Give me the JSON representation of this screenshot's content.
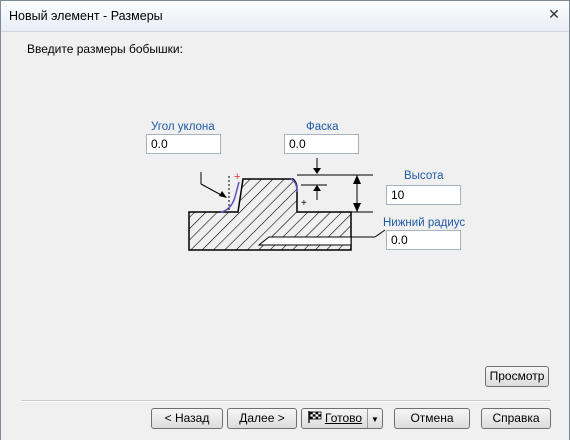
{
  "window": {
    "title": "Новый элемент - Размеры",
    "close_glyph": "✕"
  },
  "prompt": "Введите размеры бобышки:",
  "fields": {
    "draft_angle": {
      "label": "Угол уклона",
      "value": "0.0"
    },
    "chamfer": {
      "label": "Фаска",
      "value": "0.0"
    },
    "height": {
      "label": "Высота",
      "value": "10"
    },
    "bottom_radius": {
      "label": "Нижний радиус",
      "value": "0.0"
    }
  },
  "buttons": {
    "preview": "Просмотр",
    "back": "< Назад",
    "next": "Далее >",
    "finish": "Готово",
    "cancel": "Отмена",
    "help": "Справка"
  },
  "icons": {
    "finish": "checkered-flag-icon",
    "split": "chevron-down-icon"
  },
  "colors": {
    "label": "#1f5aa6",
    "marker": "#e0303a",
    "outline_highlight": "#6a4fc8"
  }
}
